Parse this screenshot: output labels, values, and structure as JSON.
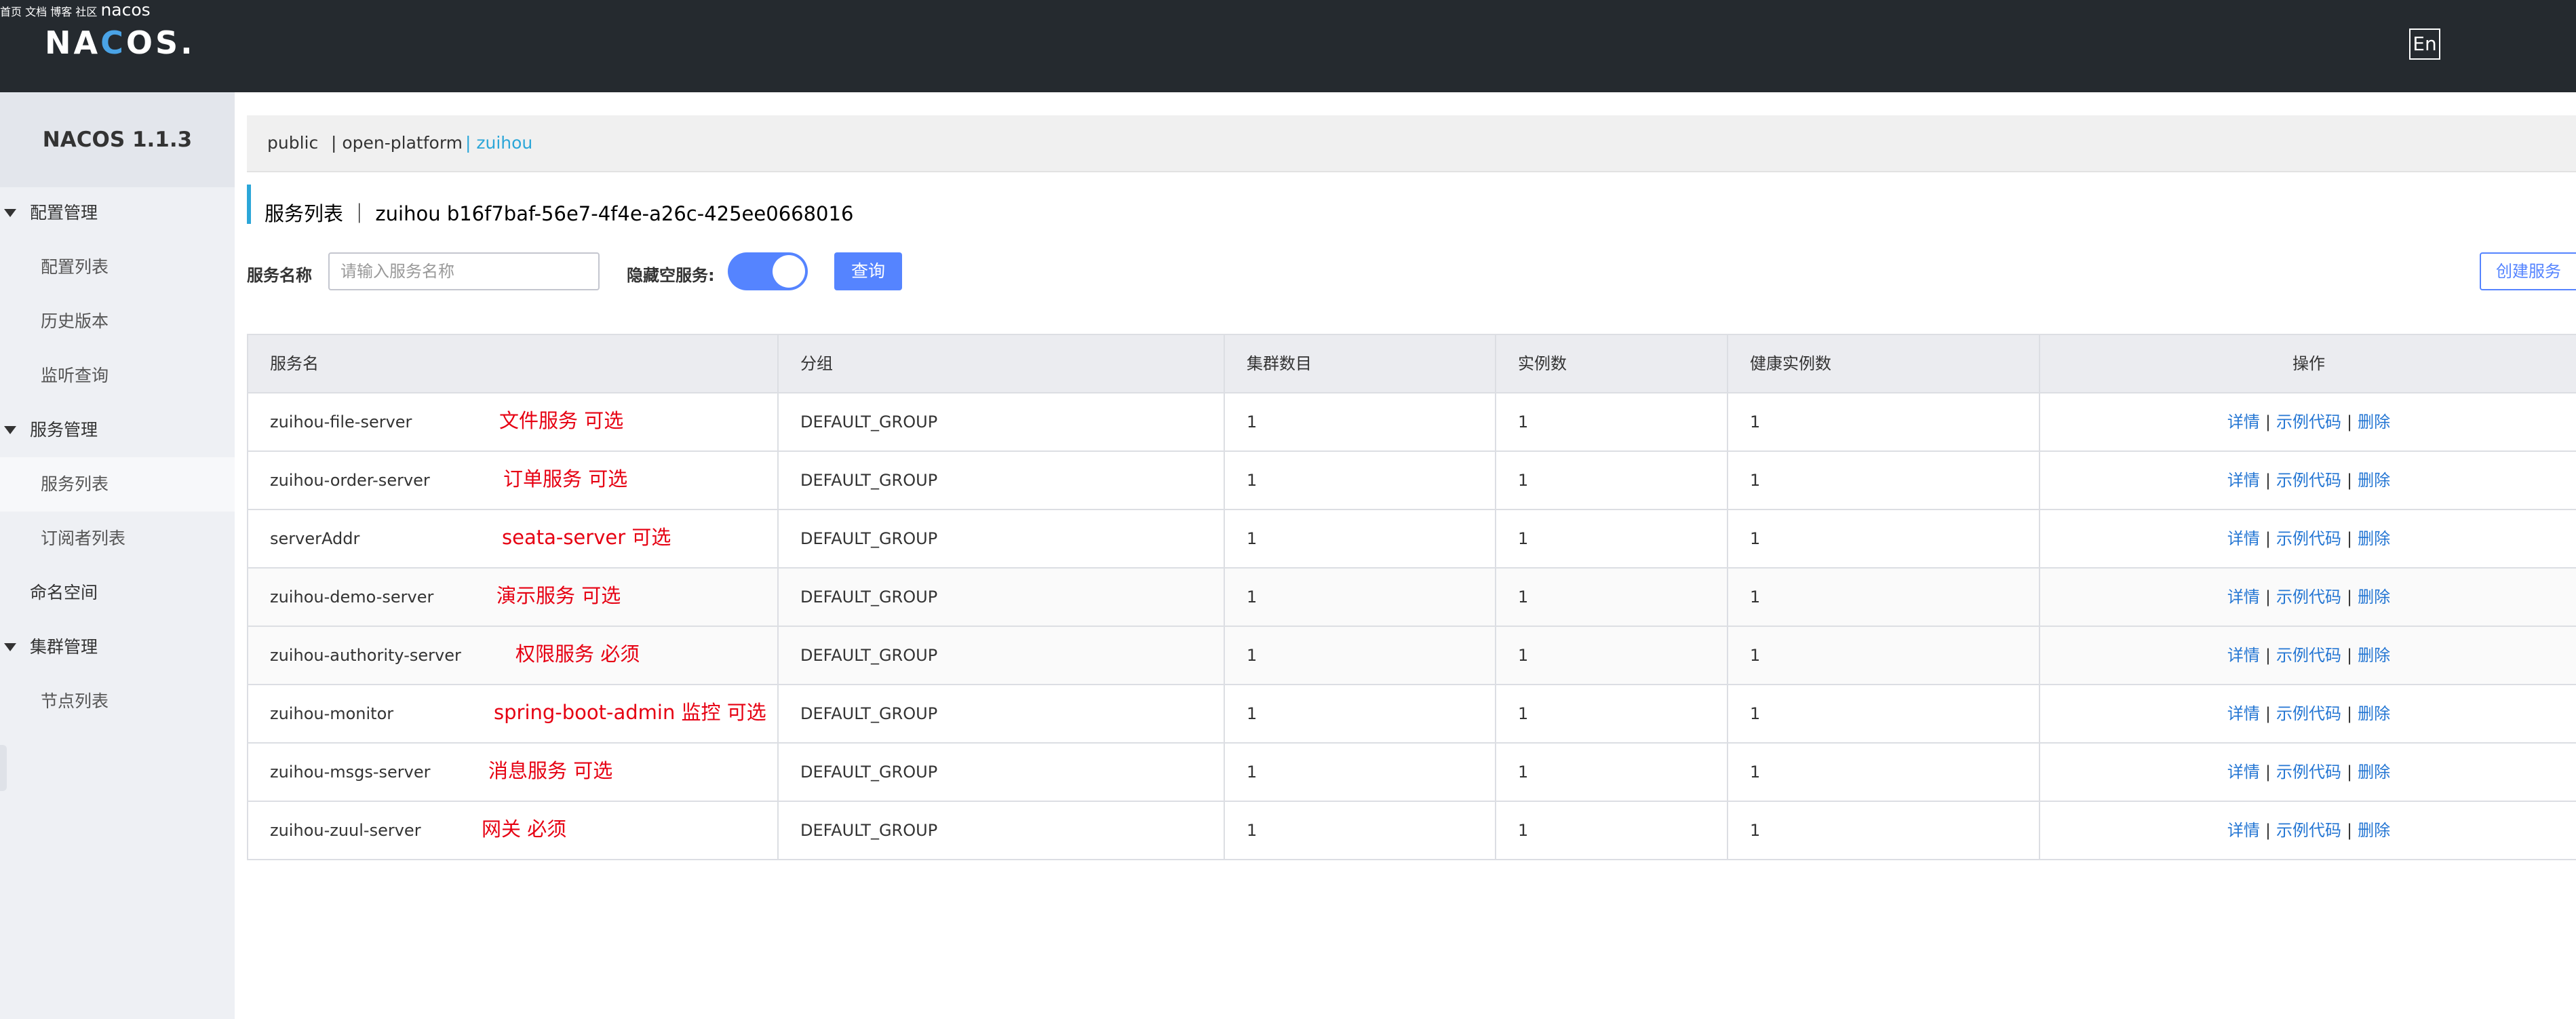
{
  "topbar": {
    "logo_pre": "NA",
    "logo_mark": "C",
    "logo_post": "OS.",
    "nav": [
      "首页",
      "文档",
      "博客",
      "社区"
    ],
    "lang": "En",
    "user": "nacos"
  },
  "sidebar": {
    "title": "NACOS 1.1.3",
    "items": [
      {
        "label": "配置管理",
        "type": "group"
      },
      {
        "label": "配置列表",
        "type": "sub"
      },
      {
        "label": "历史版本",
        "type": "sub"
      },
      {
        "label": "监听查询",
        "type": "sub"
      },
      {
        "label": "服务管理",
        "type": "group"
      },
      {
        "label": "服务列表",
        "type": "sub",
        "active": true
      },
      {
        "label": "订阅者列表",
        "type": "sub"
      },
      {
        "label": "命名空间",
        "type": "plain"
      },
      {
        "label": "集群管理",
        "type": "group"
      },
      {
        "label": "节点列表",
        "type": "sub"
      }
    ]
  },
  "namespaces": {
    "items": [
      "public",
      "| open-platform",
      "| zuihou"
    ],
    "active_index": 2
  },
  "page": {
    "title": "服务列表 ｜ zuihou  b16f7baf-56e7-4f4e-a26c-425ee0668016"
  },
  "search": {
    "service_name_label": "服务名称",
    "service_name_placeholder": "请输入服务名称",
    "service_name_value": "",
    "hide_empty_label": "隐藏空服务:",
    "hide_empty_on": true,
    "query_button": "查询",
    "create_button": "创建服务"
  },
  "table": {
    "columns": [
      "服务名",
      "分组",
      "集群数目",
      "实例数",
      "健康实例数",
      "操作"
    ],
    "actions": [
      "详情",
      "示例代码",
      "删除"
    ],
    "rows": [
      {
        "name": "zuihou-file-server",
        "note": "文件服务 可选",
        "group": "DEFAULT_GROUP",
        "clusters": "1",
        "instances": "1",
        "healthy": "1"
      },
      {
        "name": "zuihou-order-server",
        "note": "订单服务 可选",
        "group": "DEFAULT_GROUP",
        "clusters": "1",
        "instances": "1",
        "healthy": "1"
      },
      {
        "name": "serverAddr",
        "note": "seata-server 可选",
        "group": "DEFAULT_GROUP",
        "clusters": "1",
        "instances": "1",
        "healthy": "1"
      },
      {
        "name": "zuihou-demo-server",
        "note": "演示服务 可选",
        "group": "DEFAULT_GROUP",
        "clusters": "1",
        "instances": "1",
        "healthy": "1"
      },
      {
        "name": "zuihou-authority-server",
        "note": "权限服务 必须",
        "group": "DEFAULT_GROUP",
        "clusters": "1",
        "instances": "1",
        "healthy": "1"
      },
      {
        "name": "zuihou-monitor",
        "note": "spring-boot-admin 监控 可选",
        "group": "DEFAULT_GROUP",
        "clusters": "1",
        "instances": "1",
        "healthy": "1"
      },
      {
        "name": "zuihou-msgs-server",
        "note": "消息服务 可选",
        "group": "DEFAULT_GROUP",
        "clusters": "1",
        "instances": "1",
        "healthy": "1"
      },
      {
        "name": "zuihou-zuul-server",
        "note": "网关 必须",
        "group": "DEFAULT_GROUP",
        "clusters": "1",
        "instances": "1",
        "healthy": "1"
      }
    ]
  },
  "colors": {
    "topbar": "#252a2f",
    "primary": "#5584ff",
    "link": "#2476d3",
    "active_namespace": "#2ba6d8",
    "annotation": "#e60012"
  }
}
